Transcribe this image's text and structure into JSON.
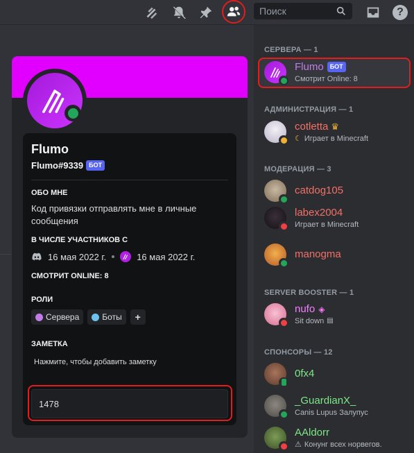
{
  "toolbar": {
    "search_placeholder": "Поиск",
    "icons": [
      "threads-icon",
      "mute-bell-icon",
      "pin-icon",
      "members-icon",
      "search-icon",
      "inbox-icon",
      "help-icon"
    ],
    "help_label": "?"
  },
  "profile": {
    "name": "Flumo",
    "tag": "Flumo#9339",
    "bot_badge": "БОТ",
    "banner_color": "#e100ff",
    "about_header": "Обо мне",
    "about_text": "Код привязки отправлять мне в личные сообщения",
    "member_since_header": "В числе участников с",
    "discord_since": "16 мая 2022 г.",
    "server_since": "16 мая 2022 г.",
    "activity_header": "Смотрит Online: 8",
    "roles_header": "Роли",
    "roles": [
      {
        "name": "Сервера",
        "color": "#c27ce8"
      },
      {
        "name": "Боты",
        "color": "#6cc3f0"
      }
    ],
    "add_role": "+",
    "note_header": "Заметка",
    "note_placeholder": "Нажмите, чтобы добавить заметку",
    "message_value": "1478"
  },
  "members": {
    "groups": [
      {
        "title": "Сервера — 1"
      },
      {
        "title": "Администрация — 1"
      },
      {
        "title": "Модерация — 3"
      },
      {
        "title": "Server Booster — 1"
      },
      {
        "title": "Спонсоры — 12"
      }
    ],
    "items": [
      {
        "name": "Flumo",
        "badge": "БОТ",
        "sub": "Смотрит Online: 8",
        "name_color": "#c27ce8"
      },
      {
        "name": "cotletta",
        "sub": "Играет в Minecraft",
        "name_color": "#f47067"
      },
      {
        "name": "catdog105",
        "sub": "",
        "name_color": "#f47067"
      },
      {
        "name": "labex2004",
        "sub": "Играет в Minecraft",
        "name_color": "#f47067"
      },
      {
        "name": "manogma",
        "sub": "",
        "name_color": "#f47067"
      },
      {
        "name": "nufo",
        "sub": "Sit down",
        "name_color": "#f47fff"
      },
      {
        "name": "0fx4",
        "sub": "",
        "name_color": "#7ee787"
      },
      {
        "name": "_GuardianX_",
        "sub": "Canis Lupus Залупус",
        "name_color": "#7ee787"
      },
      {
        "name": "AAldorr",
        "sub": "Конунг всех норвегов.",
        "name_color": "#7ee787"
      }
    ]
  },
  "colors": {
    "online": "#23a55a",
    "dnd": "#f23f43",
    "idle": "#f0b232",
    "highlight": "#e11d1d"
  }
}
